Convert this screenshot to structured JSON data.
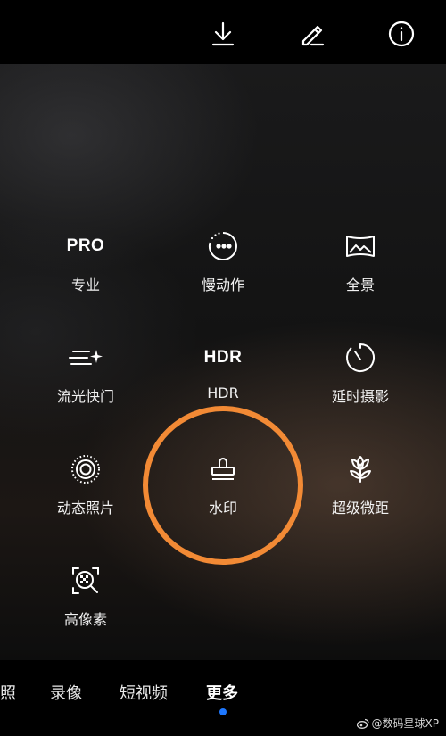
{
  "toolbar": {
    "download_icon": "download-icon",
    "edit_icon": "pencil-icon",
    "info_icon": "info-icon"
  },
  "modes": [
    {
      "id": "pro",
      "glyph_text": "PRO",
      "label": "专业",
      "icon": "pro-text"
    },
    {
      "id": "slow-motion",
      "label": "慢动作",
      "icon": "slow-motion-icon"
    },
    {
      "id": "panorama",
      "label": "全景",
      "icon": "panorama-icon"
    },
    {
      "id": "light-painting",
      "label": "流光快门",
      "icon": "light-painting-icon"
    },
    {
      "id": "hdr",
      "glyph_text": "HDR",
      "label": "HDR",
      "icon": "hdr-text"
    },
    {
      "id": "time-lapse",
      "label": "延时摄影",
      "icon": "timer-icon"
    },
    {
      "id": "moving-picture",
      "label": "动态照片",
      "icon": "moving-picture-icon"
    },
    {
      "id": "watermark",
      "label": "水印",
      "icon": "stamp-icon"
    },
    {
      "id": "super-macro",
      "label": "超级微距",
      "icon": "flower-icon"
    },
    {
      "id": "high-res",
      "label": "高像素",
      "icon": "high-res-icon"
    }
  ],
  "highlight_color": "#f28a35",
  "tabs": [
    {
      "label": "照",
      "active": false
    },
    {
      "label": "录像",
      "active": false
    },
    {
      "label": "短视频",
      "active": false
    },
    {
      "label": "更多",
      "active": true
    }
  ],
  "active_indicator_color": "#1e78ff",
  "watermark_text": "@数码星球XP"
}
